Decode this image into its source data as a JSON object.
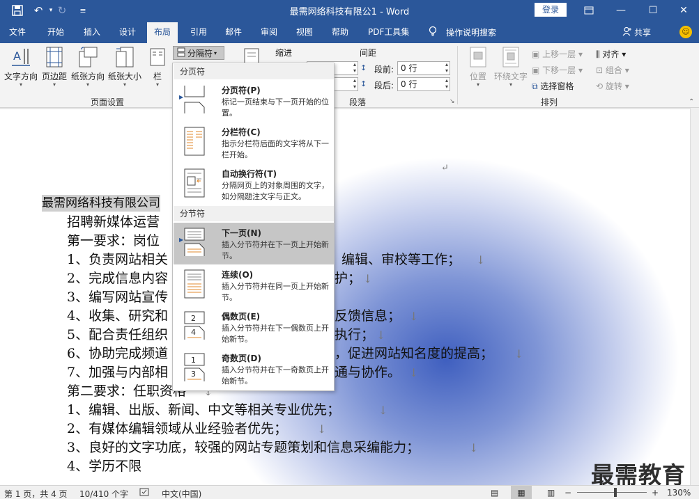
{
  "window": {
    "title": "最需网络科技有限公1 - Word",
    "login_label": "登录"
  },
  "tabs": [
    "文件",
    "开始",
    "插入",
    "设计",
    "布局",
    "引用",
    "邮件",
    "审阅",
    "视图",
    "帮助",
    "PDF工具集"
  ],
  "active_tab": "布局",
  "tell_me": "操作说明搜索",
  "share_label": "共享",
  "ribbon": {
    "page_setup": {
      "text_direction": "文字方向",
      "margins": "页边距",
      "orientation": "纸张方向",
      "size": "纸张大小",
      "columns": "栏",
      "group_label": "页面设置"
    },
    "breaks_label": "分隔符",
    "paragraph": {
      "indent_label": "缩进",
      "spacing_label": "间距",
      "before_label": "段前:",
      "before_value": "0 行",
      "after_label": "段后:",
      "after_value": "0 行",
      "group_label": "段落"
    },
    "arrange": {
      "position": "位置",
      "wrap_text": "环绕文字",
      "bring_forward": "上移一层",
      "send_backward": "下移一层",
      "selection_pane": "选择窗格",
      "align": "对齐",
      "group": "组合",
      "rotate": "旋转",
      "group_label": "排列"
    }
  },
  "breaks_menu": {
    "page_breaks_header": "分页符",
    "section_breaks_header": "分节符",
    "items": [
      {
        "name": "分页符(P)",
        "desc": "标记一页结束与下一页开始的位置。"
      },
      {
        "name": "分栏符(C)",
        "desc": "指示分栏符后面的文字将从下一栏开始。"
      },
      {
        "name": "自动换行符(T)",
        "desc": "分隔网页上的对象周围的文字，如分隔题注文字与正文。"
      },
      {
        "name": "下一页(N)",
        "desc": "插入分节符并在下一页上开始新节。"
      },
      {
        "name": "连续(O)",
        "desc": "插入分节符并在同一页上开始新节。"
      },
      {
        "name": "偶数页(E)",
        "desc": "插入分节符并在下一偶数页上开始新节。"
      },
      {
        "name": "奇数页(D)",
        "desc": "插入分节符并在下一奇数页上开始新节。"
      }
    ]
  },
  "document": {
    "lines": [
      "最需网络科技有限公司",
      "招聘新媒体运营",
      "第一要求：岗位",
      "1、负责网站相关",
      "2、完成信息内容",
      "3、编写网站宣传",
      "4、收集、研究和",
      "5、配合责任组织",
      "6、协助完成频道",
      "7、加强与内部相",
      "第二要求：任职资格",
      "1、编辑、出版、新闻、中文等相关专业优先；",
      "2、有媒体编辑领域从业经验者优先；",
      "3、良好的文字功底，较强的网站专题策划和信息采编能力；",
      "4、学历不限"
    ],
    "right_fragments": [
      "编辑、审校等工作；",
      "护；",
      "反馈信息；",
      "执行；",
      "，促进网站知名度的提高；",
      "通与协作。"
    ],
    "paragraph_mark": "↓",
    "return_mark": "↵"
  },
  "statusbar": {
    "page": "第 1 页，共 4 页",
    "words": "10/410 个字",
    "language": "中文(中国)",
    "zoom": "130%"
  },
  "watermark": "最需教育"
}
